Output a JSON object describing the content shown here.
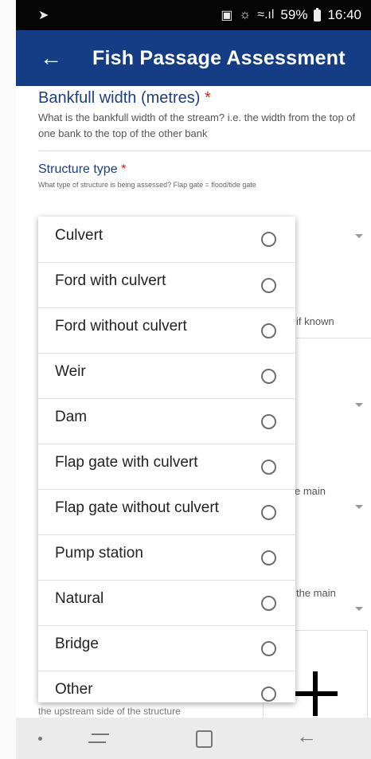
{
  "status_bar": {
    "cast_icon": "cast-icon",
    "signal": "59%",
    "time": "16:40"
  },
  "app_bar": {
    "title": "Fish Passage Assessment"
  },
  "form": {
    "q1": {
      "title": "Bankfull width (metres)",
      "required_mark": "*",
      "help": "What is the bankfull width of the stream? i.e. the width from the top of one bank to the top of the other bank"
    },
    "q2": {
      "title": "Structure type",
      "required_mark": "*",
      "help": "What type of structure is being assessed? Flap gate = flood/tide gate"
    },
    "peek": {
      "if_known": "if known",
      "e_main": "e main",
      "the_main": "the main"
    },
    "bottom_help": "the upstream side of the structure"
  },
  "dropdown": {
    "options": [
      {
        "label": "Culvert"
      },
      {
        "label": "Ford with culvert"
      },
      {
        "label": "Ford without culvert"
      },
      {
        "label": "Weir"
      },
      {
        "label": "Dam"
      },
      {
        "label": "Flap gate with culvert"
      },
      {
        "label": "Flap gate without culvert"
      },
      {
        "label": "Pump station"
      },
      {
        "label": "Natural"
      },
      {
        "label": "Bridge"
      },
      {
        "label": "Other"
      }
    ]
  },
  "colors": {
    "app_bar": "#153d85",
    "question_title": "#1d3f86",
    "required": "#d92020"
  }
}
